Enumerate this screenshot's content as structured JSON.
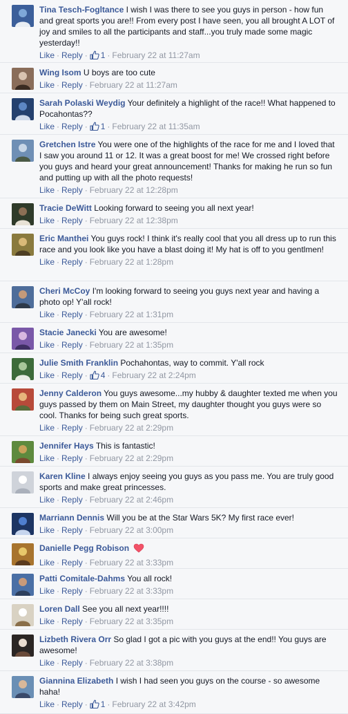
{
  "labels": {
    "like": "Like",
    "reply": "Reply",
    "sep": "·"
  },
  "colors": {
    "link": "#3b5998",
    "meta": "#9197a3",
    "background": "#f6f7f9",
    "heart": "#f25268"
  },
  "comments": [
    {
      "author": "Tina Tesch-Fogltance",
      "text": "I wish I was there to see you guys in person - how fun and great sports you are!! From every post I have seen, you all brought A LOT of joy and smiles to all the participants and staff...you truly made some magic yesterday!!",
      "likes": "1",
      "time": "February 22 at 11:27am",
      "avatar": [
        "#3c5f9a",
        "#7fa8d8",
        "#e9eef4"
      ]
    },
    {
      "author": "Wing Isom",
      "text": "U boys are too cute",
      "likes": null,
      "time": "February 22 at 11:27am",
      "avatar": [
        "#8a6d5a",
        "#d9c3b0",
        "#3a2b22"
      ]
    },
    {
      "author": "Sarah Polaski Weydig",
      "text": "Your definitely a highlight of the race!! What happened to Pocahontas??",
      "likes": "1",
      "time": "February 22 at 11:35am",
      "avatar": [
        "#24406e",
        "#5c86c4",
        "#cfd9ea"
      ]
    },
    {
      "author": "Gretchen Istre",
      "text": "You were one of the highlights of the race for me and I loved that I saw you around 11 or 12. It was a great boost for me! We crossed right before you guys and heard your great announcement! Thanks for making he run so fun and putting up with all the photo requests!",
      "likes": null,
      "time": "February 22 at 12:28pm",
      "avatar": [
        "#6f8fb5",
        "#c8d6e6",
        "#4b5a46"
      ]
    },
    {
      "author": "Tracie DeWitt",
      "text": "Looking forward to seeing you all next year!",
      "likes": null,
      "time": "February 22 at 12:38pm",
      "avatar": [
        "#2f3b2a",
        "#8c6f55",
        "#e8e2d6"
      ]
    },
    {
      "author": "Eric Manthei",
      "text": "You guys rock! I think it's really cool that you all dress up to run this race and you look like you have a blast doing it! My hat is off to you gentlmen!",
      "likes": null,
      "time": "February 22 at 1:28pm",
      "avatar": [
        "#8a7a3e",
        "#d9b978",
        "#4e3f24"
      ]
    },
    {
      "author": "Cheri McCoy",
      "text": "I'm looking forward to seeing you guys next year and having a photo op! Y'all rock!",
      "likes": null,
      "time": "February 22 at 1:31pm",
      "avatar": [
        "#4e6d9a",
        "#c49a7a",
        "#2e3a4a"
      ]
    },
    {
      "author": "Stacie Janecki",
      "text": "You are awesome!",
      "likes": null,
      "time": "February 22 at 1:35pm",
      "avatar": [
        "#7a58a8",
        "#d8b7e0",
        "#3f2f63"
      ]
    },
    {
      "author": "Julie Smith Franklin",
      "text": "Pochahontas, way to commit. Y'all rock",
      "likes": "4",
      "time": "February 22 at 2:24pm",
      "avatar": [
        "#3d6b3a",
        "#a8c79a",
        "#e9ede4"
      ]
    },
    {
      "author": "Jenny Calderon",
      "text": "You guys awesome...my hubby & daughter texted me when you guys passed by them on Main Street, my daughter thought you guys were so cool. Thanks for being such great sports.",
      "likes": null,
      "time": "February 22 at 2:29pm",
      "avatar": [
        "#b84a3a",
        "#e7b57c",
        "#5a6b3a"
      ]
    },
    {
      "author": "Jennifer Hays",
      "text": "This is fantastic!",
      "likes": null,
      "time": "February 22 at 2:29pm",
      "avatar": [
        "#5e8a3e",
        "#c9a25a",
        "#7a4a2e"
      ]
    },
    {
      "author": "Karen Kline",
      "text": "I always enjoy seeing you guys as you pass me. You are truly good sports and make great princesses.",
      "likes": null,
      "time": "February 22 at 2:46pm",
      "avatar": [
        "#cfd3da",
        "#ffffff",
        "#aab0bb"
      ]
    },
    {
      "author": "Marriann Dennis",
      "text": "Will you be at the Star Wars 5K? My first race ever!",
      "likes": null,
      "time": "February 22 at 3:00pm",
      "avatar": [
        "#1d3563",
        "#4f7fcf",
        "#c6d5ee"
      ]
    },
    {
      "author": "Danielle Pegg Robison",
      "text": "",
      "heart": true,
      "likes": null,
      "time": "February 22 at 3:33pm",
      "avatar": [
        "#a8742e",
        "#e8c86a",
        "#5a3a1e"
      ]
    },
    {
      "author": "Patti Comitale-Dahms",
      "text": "You all rock!",
      "likes": null,
      "time": "February 22 at 3:33pm",
      "avatar": [
        "#4a6fa5",
        "#c99a7a",
        "#2c3e5c"
      ]
    },
    {
      "author": "Loren Dall",
      "text": "See you all next year!!!!",
      "likes": null,
      "time": "February 22 at 3:35pm",
      "avatar": [
        "#d9d2c3",
        "#ffffff",
        "#8a6f4a"
      ]
    },
    {
      "author": "Lizbeth Rivera Orr",
      "text": "So glad I got a pic with you guys at the end!! You guys are awesome!",
      "likes": null,
      "time": "February 22 at 3:38pm",
      "avatar": [
        "#2b2624",
        "#e9dcd0",
        "#6a4b3a"
      ]
    },
    {
      "author": "Giannina Elizabeth",
      "text": "I wish I had seen you guys on the course - so awesome haha!",
      "likes": "1",
      "time": "February 22 at 3:42pm",
      "avatar": [
        "#6a8fb5",
        "#d9b89a",
        "#3a4a6a"
      ]
    }
  ]
}
